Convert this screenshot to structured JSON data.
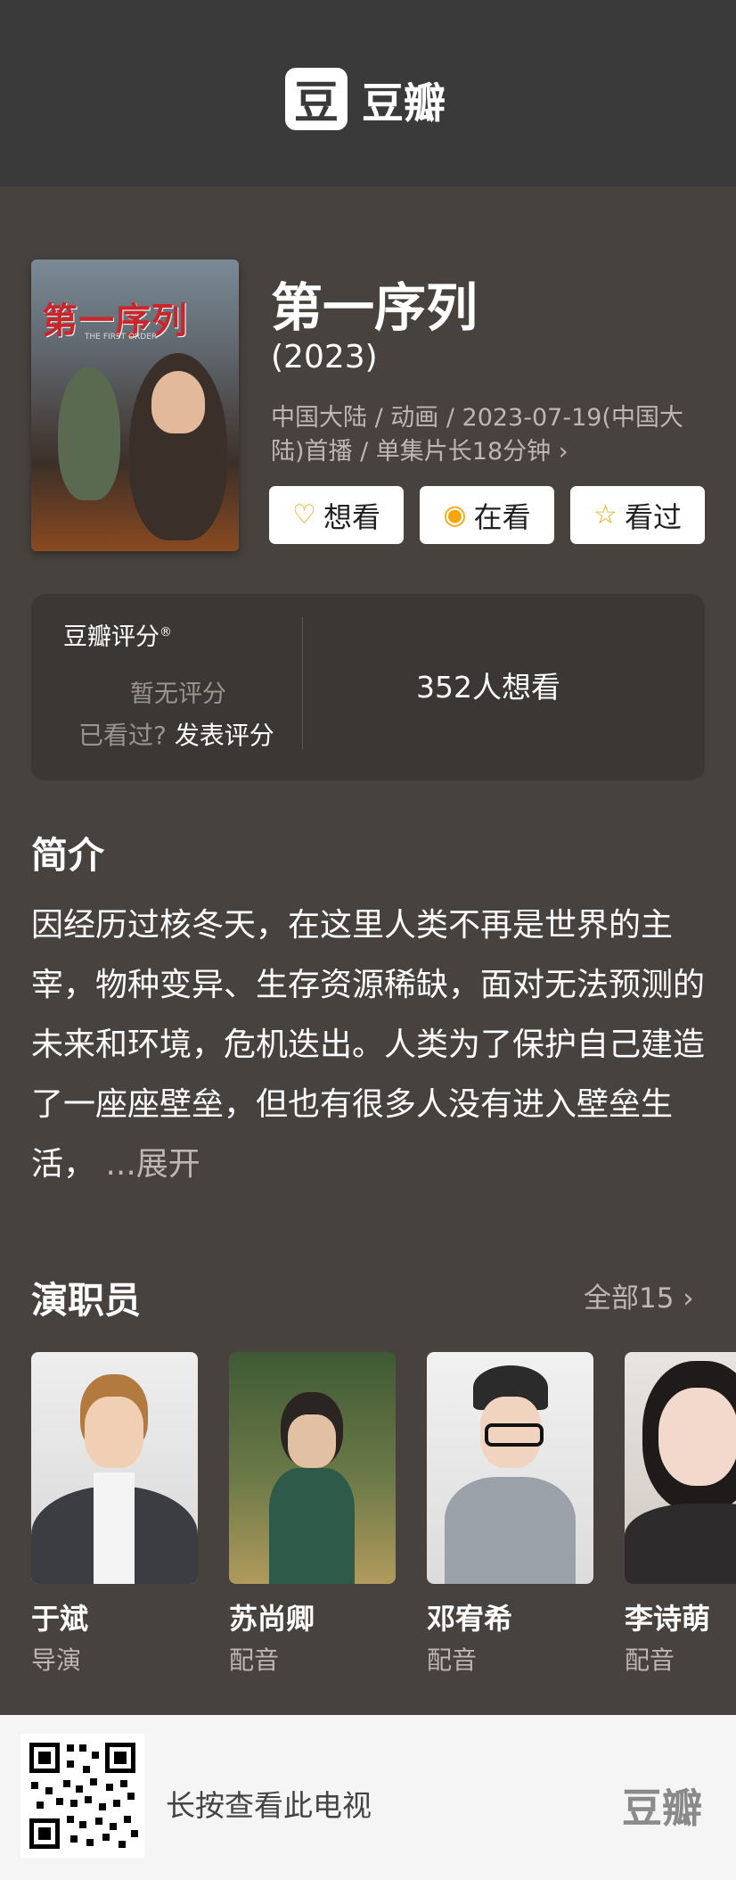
{
  "header": {
    "logo_char": "豆",
    "logo_text": "豆瓣"
  },
  "poster": {
    "title_art": "第一序列",
    "subtitle_art": "THE FIRST ORDER"
  },
  "movie": {
    "title": "第一序列",
    "year": "(2023)",
    "meta": "中国大陆 / 动画 / 2023-07-19(中国大陆)首播 / 单集片长18分钟 ›"
  },
  "actions": [
    {
      "icon": "heart-plus-icon",
      "label": "想看"
    },
    {
      "icon": "target-icon",
      "label": "在看"
    },
    {
      "icon": "star-icon",
      "label": "看过"
    }
  ],
  "rating": {
    "title": "豆瓣评分",
    "mark": "®",
    "none": "暂无评分",
    "seen_prompt": "已看过?",
    "rate_link": "发表评分",
    "want_count": "352人想看"
  },
  "intro": {
    "title": "简介",
    "text": "因经历过核冬天，在这里人类不再是世界的主宰，物种变异、生存资源稀缺，面对无法预测的未来和环境，危机迭出。人类为了保护自己建造了一座座壁垒，但也有很多人没有进入壁垒生活，",
    "more": "...展开"
  },
  "cast": {
    "title": "演职员",
    "all": "全部15 ›",
    "members": [
      {
        "name": "于斌",
        "role": "导演"
      },
      {
        "name": "苏尚卿",
        "role": "配音"
      },
      {
        "name": "邓宥希",
        "role": "配音"
      },
      {
        "name": "李诗萌",
        "role": "配音"
      }
    ]
  },
  "footer": {
    "hint": "长按查看此电视",
    "logo": "豆瓣"
  },
  "colors": {
    "background": "#48423f",
    "header": "#3a3a3a",
    "accent": "#f4a60b",
    "card": "#3a3734"
  }
}
